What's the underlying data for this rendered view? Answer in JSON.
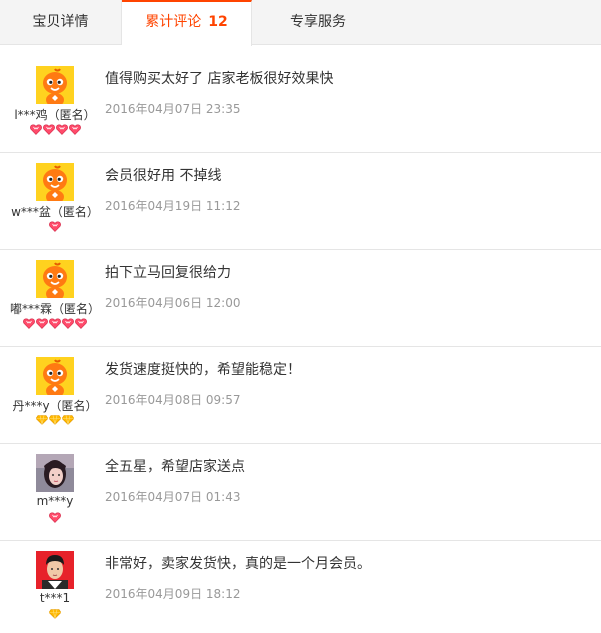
{
  "tabs": [
    {
      "label": "宝贝详情"
    },
    {
      "label": "累计评论",
      "count": "12"
    },
    {
      "label": "专享服务"
    }
  ],
  "colors": {
    "accent": "#ff4400",
    "heart": "#ff4a6a",
    "diamond": "#ffb800"
  },
  "reviews": [
    {
      "user": "l***鸡（匿名）",
      "avatar": "orange-mascot",
      "badge": "heart",
      "badge_count": 4,
      "content": "值得购买太好了 店家老板很好效果快",
      "date": "2016年04月07日 23:35"
    },
    {
      "user": "w***盆（匿名）",
      "avatar": "orange-mascot",
      "badge": "heart",
      "badge_count": 1,
      "content": "会员很好用 不掉线",
      "date": "2016年04月19日 11:12"
    },
    {
      "user": "嘟***霖（匿名）",
      "avatar": "orange-mascot",
      "badge": "heart",
      "badge_count": 5,
      "content": "拍下立马回复很给力",
      "date": "2016年04月06日 12:00"
    },
    {
      "user": "丹***y（匿名）",
      "avatar": "orange-mascot",
      "badge": "diamond",
      "badge_count": 3,
      "content": "发货速度挺快的，希望能稳定！",
      "date": "2016年04月08日 09:57"
    },
    {
      "user": "m***y",
      "avatar": "photo-girl",
      "badge": "heart",
      "badge_count": 1,
      "content": "全五星，希望店家送点",
      "date": "2016年04月07日 01:43"
    },
    {
      "user": "t***1",
      "avatar": "photo-boy",
      "badge": "diamond",
      "badge_count": 1,
      "content": "非常好，卖家发货快，真的是一个月会员。",
      "date": "2016年04月09日 18:12"
    }
  ]
}
